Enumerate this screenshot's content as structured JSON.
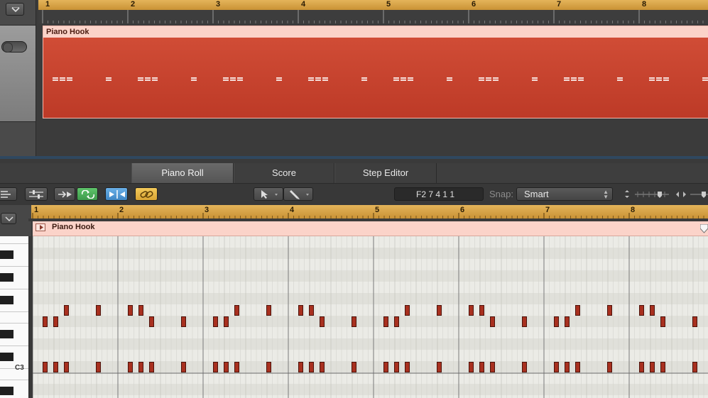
{
  "tracks": {
    "region_name": "Piano Hook",
    "bar_numbers": [
      "1",
      "2",
      "3",
      "4",
      "5",
      "6",
      "7",
      "8"
    ]
  },
  "editor": {
    "tabs": [
      {
        "label": "Piano Roll",
        "active": true
      },
      {
        "label": "Score",
        "active": false
      },
      {
        "label": "Step Editor",
        "active": false
      }
    ],
    "position_display": "F2  7 4 1 1",
    "snap_label": "Snap:",
    "snap_value": "Smart",
    "region_name": "Piano Hook",
    "bar_numbers": [
      "1",
      "2",
      "3",
      "4",
      "5",
      "6",
      "7",
      "8"
    ],
    "key_label": "C3"
  },
  "colors": {
    "ruler": "#d9a64a",
    "region": "#c6402c",
    "region_header": "#fbd3c9",
    "note": "#a8301f",
    "grid_bg": "#e6e6e0"
  },
  "icons": {
    "track_menu": "chevron-down-icon",
    "link": "link-icon",
    "pointer_tool": "pointer-tool-icon",
    "pencil_tool": "pencil-tool-icon"
  }
}
